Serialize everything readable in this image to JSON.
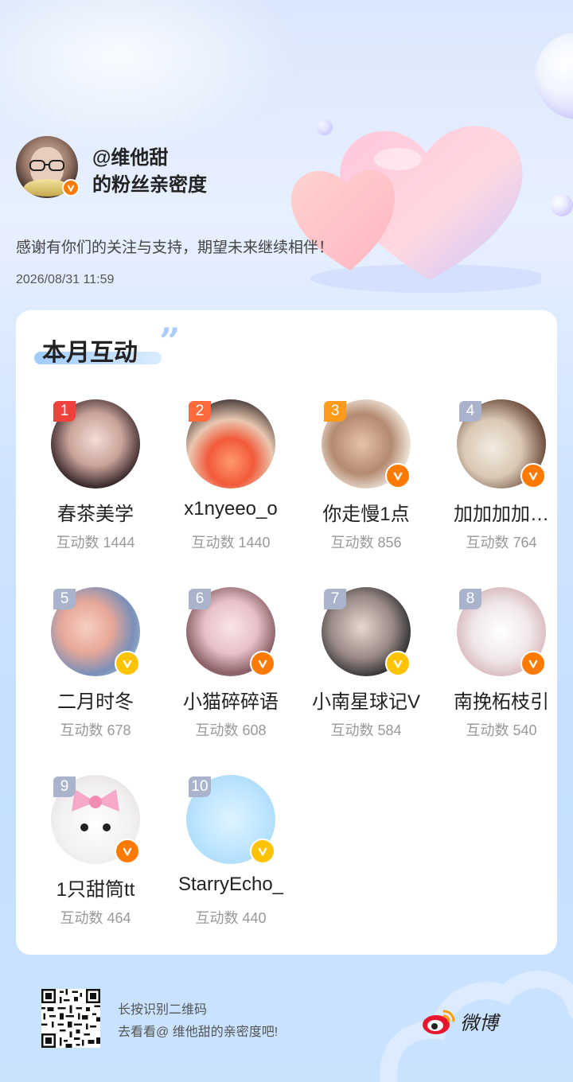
{
  "header": {
    "handle": "@维他甜",
    "subtitle": "的粉丝亲密度",
    "thanks": "感谢有你们的关注与支持，期望未来继续相伴！",
    "timestamp": "2026/08/31 11:59"
  },
  "card": {
    "title": "本月互动",
    "fans": [
      {
        "rank": "1",
        "name": "春茶美学",
        "count": "互动数 1444",
        "verified": "none",
        "rank_color": "#f0423c"
      },
      {
        "rank": "2",
        "name": "x1nyeeo_o",
        "count": "互动数 1440",
        "verified": "none",
        "rank_color": "#ff6a3d"
      },
      {
        "rank": "3",
        "name": "你走慢1点",
        "count": "互动数 856",
        "verified": "orange",
        "rank_color": "#ff9b1a"
      },
      {
        "rank": "4",
        "name": "加加加加…",
        "count": "互动数 764",
        "verified": "orange",
        "rank_color": "#a9b4cc"
      },
      {
        "rank": "5",
        "name": "二月时冬",
        "count": "互动数 678",
        "verified": "gold",
        "rank_color": "#a9b4cc"
      },
      {
        "rank": "6",
        "name": "小猫碎碎语",
        "count": "互动数 608",
        "verified": "orange",
        "rank_color": "#a9b4cc"
      },
      {
        "rank": "7",
        "name": "小南星球记V",
        "count": "互动数 584",
        "verified": "gold",
        "rank_color": "#a9b4cc"
      },
      {
        "rank": "8",
        "name": "南挽柘枝引",
        "count": "互动数 540",
        "verified": "orange",
        "rank_color": "#a9b4cc"
      },
      {
        "rank": "9",
        "name": "1只甜筒tt",
        "count": "互动数 464",
        "verified": "orange",
        "rank_color": "#a9b4cc"
      },
      {
        "rank": "10",
        "name": "StarryEcho_",
        "count": "互动数 440",
        "verified": "gold",
        "rank_color": "#a9b4cc"
      }
    ]
  },
  "footer": {
    "line1": "长按识别二维码",
    "line2": "去看看@ 维他甜的亲密度吧!",
    "brand": "微博"
  },
  "colors": {
    "verified_orange": "#ff7a00",
    "verified_gold": "#ffc300",
    "accent_blue": "#9fcbff"
  }
}
